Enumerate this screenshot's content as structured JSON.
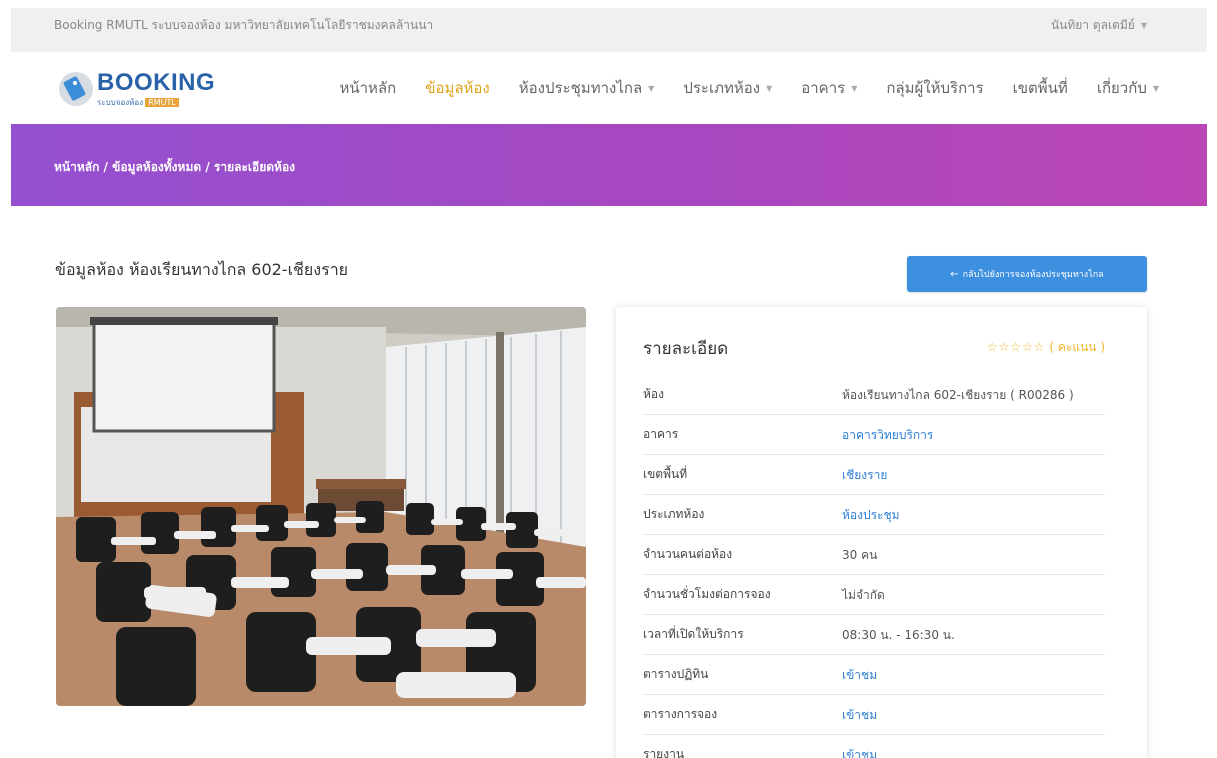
{
  "topbar": {
    "site_name": "Booking RMUTL ระบบจองห้อง มหาวิทยาลัยเทคโนโลยีราชมงคลล้านนา",
    "user_name": "นันทิยา ตุลเตมีย์"
  },
  "logo": {
    "title": "BOOKING",
    "subtitle": "ระบบจองห้อง",
    "subtitle_highlight": "RMUTL"
  },
  "nav": {
    "items": [
      {
        "label": "หน้าหลัก",
        "dropdown": false,
        "active": false
      },
      {
        "label": "ข้อมูลห้อง",
        "dropdown": false,
        "active": true
      },
      {
        "label": "ห้องประชุมทางไกล",
        "dropdown": true,
        "active": false
      },
      {
        "label": "ประเภทห้อง",
        "dropdown": true,
        "active": false
      },
      {
        "label": "อาคาร",
        "dropdown": true,
        "active": false
      },
      {
        "label": "กลุ่มผู้ให้บริการ",
        "dropdown": false,
        "active": false
      },
      {
        "label": "เขตพื้นที่",
        "dropdown": false,
        "active": false
      },
      {
        "label": "เกี่ยวกับ",
        "dropdown": true,
        "active": false
      }
    ]
  },
  "breadcrumb": "หน้าหลัก / ข้อมูลห้องทั้งหมด / รายละเอียดห้อง",
  "page_title": "ข้อมูลห้อง ห้องเรียนทางไกล 602-เชียงราย",
  "back_button": "กลับไปยังการจองห้องประชุมทางไกล",
  "details": {
    "title": "รายละเอียด",
    "rating_label": "( คะแนน )",
    "rating_stars": 0,
    "rating_max": 5,
    "rows": [
      {
        "label": "ห้อง",
        "value": "ห้องเรียนทางไกล 602-เชียงราย ( R00286 )",
        "link": false
      },
      {
        "label": "อาคาร",
        "value": "อาคารวิทยบริการ",
        "link": true
      },
      {
        "label": "เขตพื้นที่",
        "value": "เชียงราย",
        "link": true
      },
      {
        "label": "ประเภทห้อง",
        "value": "ห้องประชุม",
        "link": true
      },
      {
        "label": "จำนวนคนต่อห้อง",
        "value": "30 คน",
        "link": false
      },
      {
        "label": "จำนวนชั่วโมงต่อการจอง",
        "value": "ไม่จำกัด",
        "link": false
      },
      {
        "label": "เวลาที่เปิดให้บริการ",
        "value": "08:30 น. - 16:30 น.",
        "link": false
      },
      {
        "label": "ตารางปฏิทิน",
        "value": "เข้าชม",
        "link": true
      },
      {
        "label": "ตารางการจอง",
        "value": "เข้าชม",
        "link": true
      },
      {
        "label": "รายงาน",
        "value": "เข้าชม",
        "link": true
      }
    ]
  },
  "colors": {
    "accent_active": "#e0a31c",
    "link": "#2f7fd6",
    "button": "#3d8fe0",
    "hero_start": "#9450d1",
    "hero_end": "#bb45b5",
    "star": "#f0b52a"
  }
}
